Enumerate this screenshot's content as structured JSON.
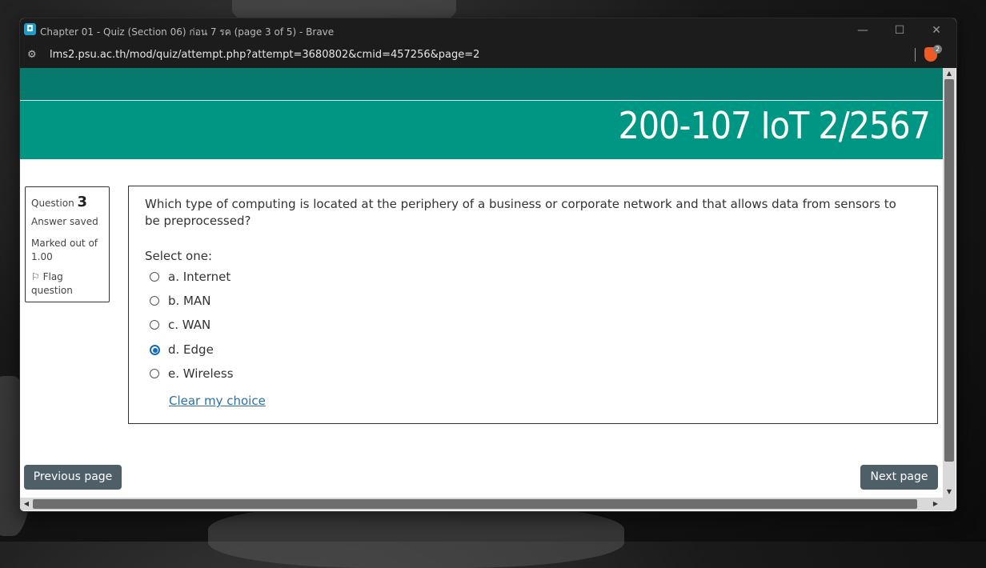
{
  "window": {
    "title": "Chapter 01 - Quiz (Section 06) ก่อน 7 รค (page 3 of 5) - Brave",
    "app_icon": "brave-app-icon",
    "controls": {
      "minimize": "—",
      "maximize": "☐",
      "close": "✕"
    }
  },
  "address_bar": {
    "url": "lms2.psu.ac.th/mod/quiz/attempt.php?attempt=3680802&cmid=457256&page=2",
    "site_info_icon": "tune-icon",
    "shield_badge": "2"
  },
  "header": {
    "course_title": "200-107 IoT 2/2567",
    "colors": {
      "top_bar": "#057a6d",
      "banner": "#009684"
    }
  },
  "question_info": {
    "label": "Question",
    "number": "3",
    "state": "Answer saved",
    "grade": "Marked out of 1.00",
    "flag": "Flag question"
  },
  "question": {
    "text": "Which type of computing is located at the periphery of a business or corporate network and that allows data from sensors to be preprocessed?",
    "prompt": "Select one:",
    "options": [
      {
        "label": "a. Internet",
        "selected": false
      },
      {
        "label": "b. MAN",
        "selected": false
      },
      {
        "label": "c. WAN",
        "selected": false
      },
      {
        "label": "d. Edge",
        "selected": true
      },
      {
        "label": "e. Wireless",
        "selected": false
      }
    ],
    "clear_choice": "Clear my choice"
  },
  "navigation": {
    "previous": "Previous page",
    "next": "Next page"
  }
}
